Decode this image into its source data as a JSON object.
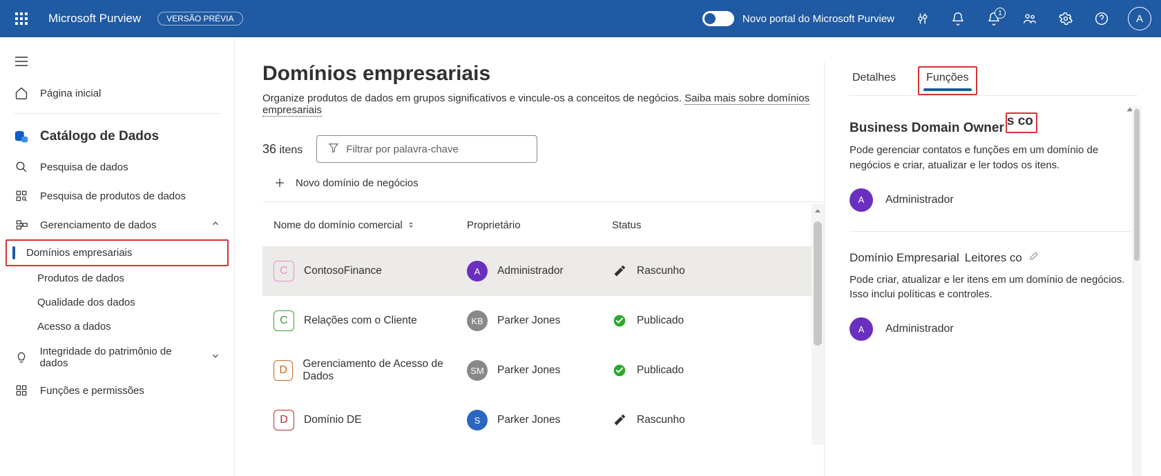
{
  "header": {
    "app_name": "Microsoft Purview",
    "preview_badge": "VERSÃO PRÉVIA",
    "portal_toggle_label": "Novo portal do Microsoft Purview",
    "notification_count": "1",
    "avatar_initial": "A"
  },
  "sidebar": {
    "home": "Página inicial",
    "catalog_section": "Catálogo de Dados",
    "items": {
      "search": "Pesquisa de dados",
      "product_search": "Pesquisa de produtos de dados",
      "data_mgmt": "Gerenciamento de dados",
      "business_domains": "Domínios empresariais",
      "data_products": "Produtos de dados",
      "data_quality": "Qualidade dos dados",
      "data_access": "Acesso a dados",
      "estate_integrity": "Integridade do patrimônio de dados",
      "roles_perms": "Funções e permissões"
    }
  },
  "main": {
    "title": "Domínios empresariais",
    "subtitle_a": "Organize produtos de dados em grupos significativos e vincule-os a conceitos de negócios. ",
    "subtitle_b": "Saiba mais sobre domínios empresariais",
    "item_count": "36",
    "item_count_label": "itens",
    "filter_placeholder": "Filtrar por palavra-chave",
    "new_domain": "Novo domínio de negócios",
    "columns": {
      "name": "Nome do domínio comercial",
      "owner": "Proprietário",
      "status": "Status"
    },
    "rows": [
      {
        "letter": "C",
        "tile_class": "c-pink",
        "name": "ContosoFinance",
        "owner_initials": "A",
        "owner_av": "av-purple",
        "owner": "Administrador",
        "status": "Rascunho",
        "status_icon": "draft",
        "selected": true
      },
      {
        "letter": "C",
        "tile_class": "c-green",
        "name": "Relações com o Cliente",
        "owner_initials": "KB",
        "owner_av": "av-grey",
        "owner": "Parker Jones",
        "status": "Publicado",
        "status_icon": "published",
        "selected": false
      },
      {
        "letter": "D",
        "tile_class": "c-orange",
        "name": "Gerenciamento de Acesso de Dados",
        "owner_initials": "SM",
        "owner_av": "av-grey",
        "owner": "Parker Jones",
        "status": "Publicado",
        "status_icon": "published",
        "selected": false
      },
      {
        "letter": "D",
        "tile_class": "c-red",
        "name": "Domínio DE",
        "owner_initials": "S",
        "owner_av": "av-blue",
        "owner": "Parker Jones",
        "status": "Rascunho",
        "status_icon": "draft",
        "selected": false
      }
    ]
  },
  "right_panel": {
    "tabs": {
      "details": "Detalhes",
      "roles": "Funções"
    },
    "role1_title_a": "Business Domain Owner",
    "role1_title_b": "s co",
    "role1_desc": "Pode gerenciar contatos e funções em um domínio de negócios e criar, atualizar e ler todos os itens.",
    "role1_member_initial": "A",
    "role1_member_name": "Administrador",
    "role2_title_a": "Domínio Empresarial",
    "role2_title_b": "Leitores co",
    "role2_desc": "Pode criar, atualizar e ler itens em um domínio de negócios. Isso inclui políticas e controles.",
    "role2_member_initial": "A",
    "role2_member_name": "Administrador"
  }
}
